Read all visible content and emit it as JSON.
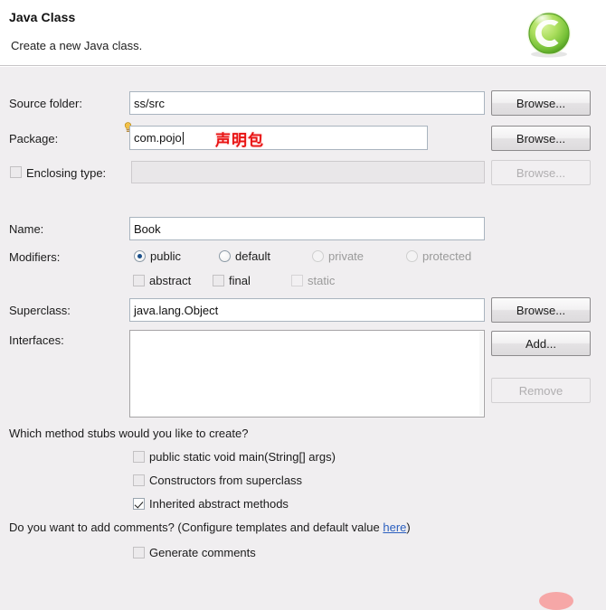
{
  "header": {
    "title": "Java Class",
    "description": "Create a new Java class.",
    "icon": "java-class-wizard-icon"
  },
  "fields": {
    "source_folder": {
      "label": "Source folder:",
      "value": "ss/src",
      "browse_label": "Browse...",
      "enabled": true
    },
    "package": {
      "label": "Package:",
      "value": "com.pojo",
      "browse_label": "Browse...",
      "enabled": true,
      "warning_icon": "lightbulb-warning-icon",
      "annotation": "声明包"
    },
    "enclosing_type": {
      "label": "Enclosing type:",
      "value": "",
      "browse_label": "Browse...",
      "enabled": false,
      "checked": false
    },
    "name": {
      "label": "Name:",
      "value": "Book"
    },
    "superclass": {
      "label": "Superclass:",
      "value": "java.lang.Object",
      "browse_label": "Browse..."
    },
    "interfaces": {
      "label": "Interfaces:",
      "items": [],
      "add_label": "Add...",
      "remove_label": "Remove",
      "remove_enabled": false
    }
  },
  "modifiers": {
    "label": "Modifiers:",
    "access": [
      {
        "label": "public",
        "selected": true,
        "enabled": true
      },
      {
        "label": "default",
        "selected": false,
        "enabled": true
      },
      {
        "label": "private",
        "selected": false,
        "enabled": false
      },
      {
        "label": "protected",
        "selected": false,
        "enabled": false
      }
    ],
    "flags": [
      {
        "label": "abstract",
        "checked": false,
        "enabled": true
      },
      {
        "label": "final",
        "checked": false,
        "enabled": true
      },
      {
        "label": "static",
        "checked": false,
        "enabled": false
      }
    ]
  },
  "method_stubs": {
    "question": "Which method stubs would you like to create?",
    "options": [
      {
        "label": "public static void main(String[] args)",
        "checked": false
      },
      {
        "label": "Constructors from superclass",
        "checked": false
      },
      {
        "label": "Inherited abstract methods",
        "checked": true
      }
    ]
  },
  "comments": {
    "question_prefix": "Do you want to add comments? (Configure templates and default value ",
    "link_label": "here",
    "question_suffix": ")",
    "option": {
      "label": "Generate comments",
      "checked": false
    }
  },
  "colors": {
    "background": "#f0eef0",
    "header_background": "#ffffff",
    "field_border": "#a9b4bf",
    "annotation_red": "#e81414",
    "link_blue": "#2b5fbf",
    "radio_dot": "#1a4f8a",
    "icon_green": "#7ac943"
  }
}
